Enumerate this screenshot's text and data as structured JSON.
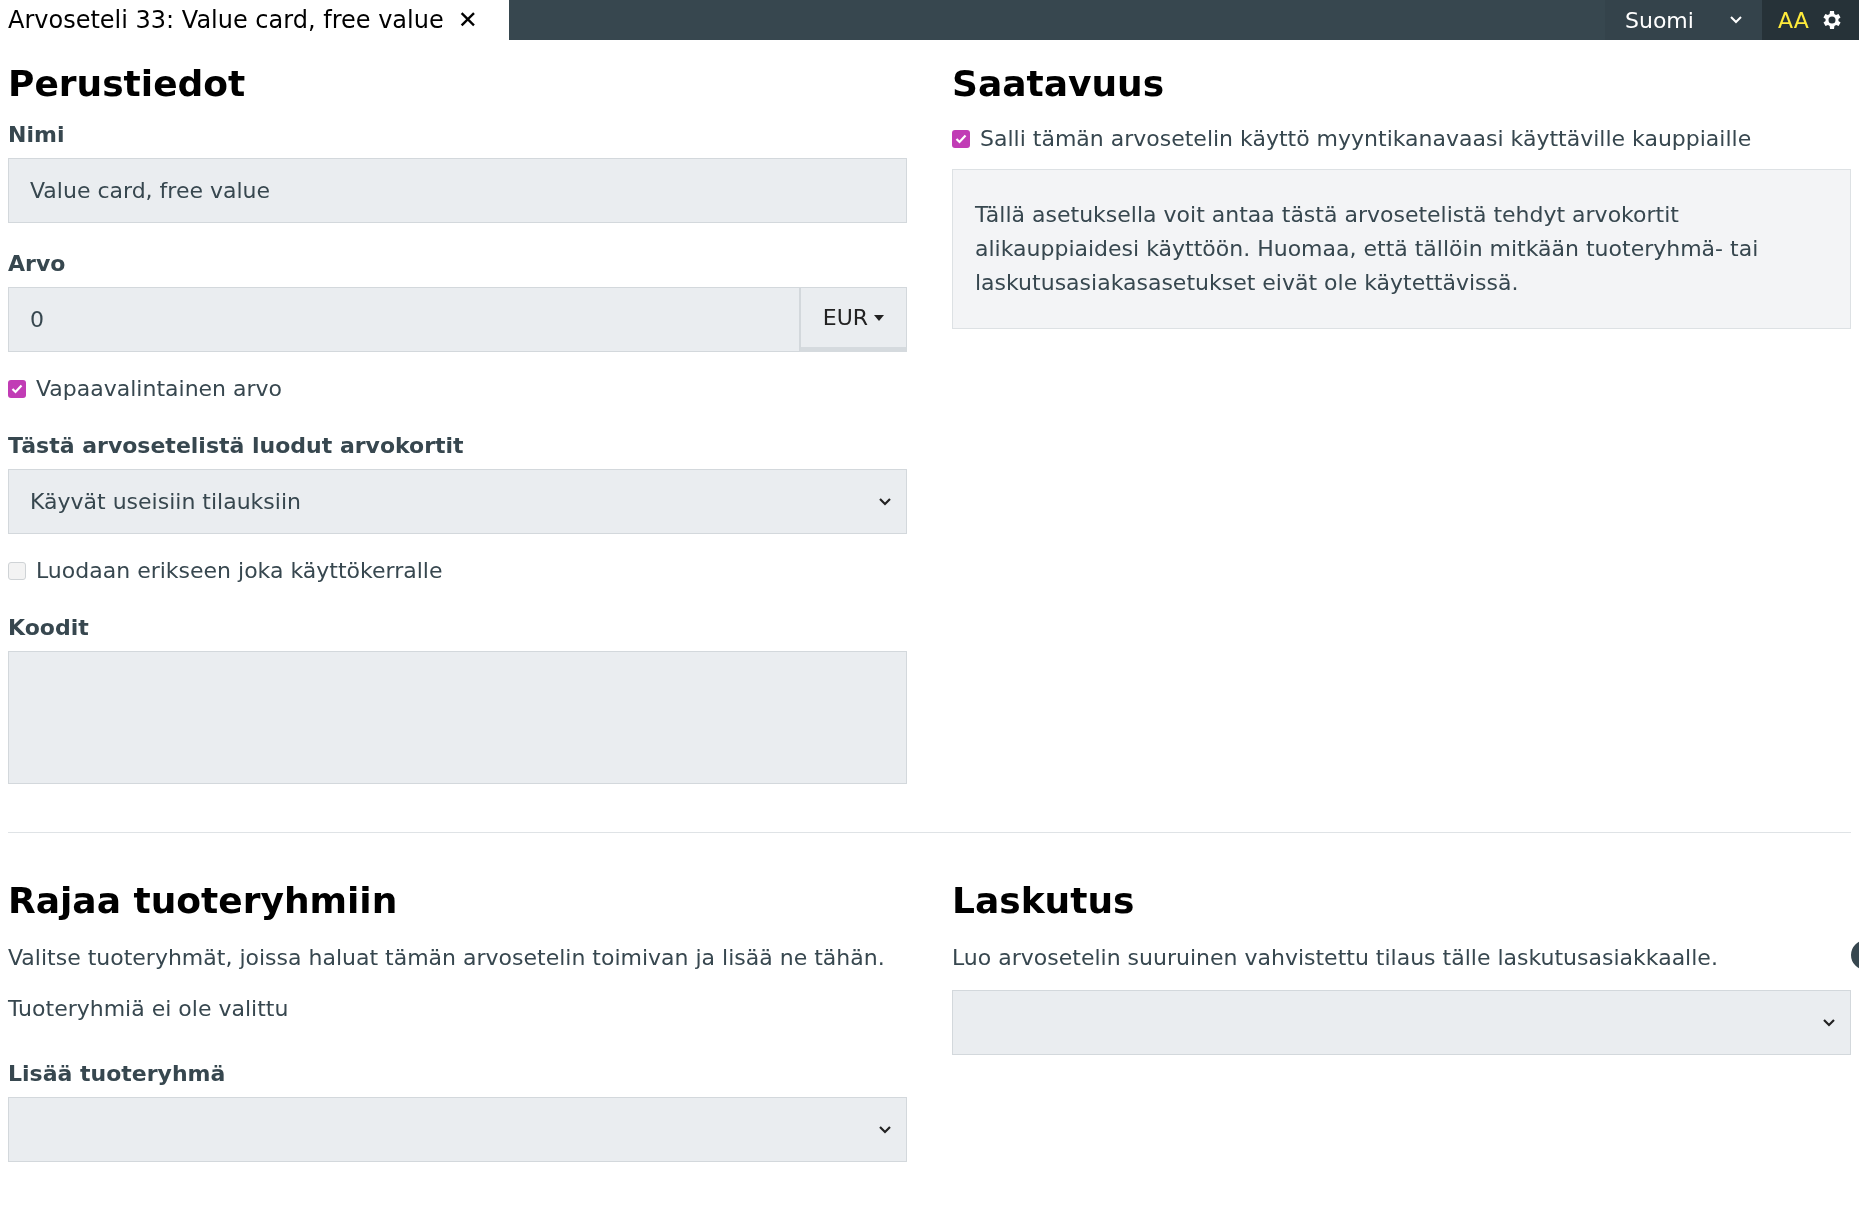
{
  "tab": {
    "title": "Arvoseteli 33: Value card, free value",
    "close": "✕"
  },
  "topbar": {
    "language": "Suomi",
    "font_size": "AA"
  },
  "basics": {
    "heading": "Perustiedot",
    "name": {
      "label": "Nimi",
      "value": "Value card, free value"
    },
    "value": {
      "label": "Arvo",
      "value": "0",
      "currency": "EUR"
    },
    "free_value": {
      "label": "Vapaavalintainen arvo",
      "checked": true
    },
    "cards": {
      "label": "Tästä arvosetelistä luodut arvokortit",
      "value": "Käyvät useisiin tilauksiin"
    },
    "separate": {
      "label": "Luodaan erikseen joka käyttökerralle",
      "checked": false
    },
    "codes": {
      "label": "Koodit"
    }
  },
  "availability": {
    "heading": "Saatavuus",
    "allow": {
      "label": "Salli tämän arvosetelin käyttö myyntikanavaasi käyttäville kauppiaille",
      "checked": true
    },
    "info": "Tällä asetuksella voit antaa tästä arvosetelistä tehdyt arvokortit alikauppiaidesi käyttöön. Huomaa, että tällöin mitkään tuoteryhmä- tai laskutusasiakasasetukset eivät ole käytettävissä."
  },
  "product_groups": {
    "heading": "Rajaa tuoteryhmiin",
    "description": "Valitse tuoteryhmät, joissa haluat tämän arvosetelin toimivan ja lisää ne tähän.",
    "empty": "Tuoteryhmiä ei ole valittu",
    "add_label": "Lisää tuoteryhmä"
  },
  "billing": {
    "heading": "Laskutus",
    "description": "Luo arvosetelin suuruinen vahvistettu tilaus tälle laskutusasiakkaalle."
  }
}
